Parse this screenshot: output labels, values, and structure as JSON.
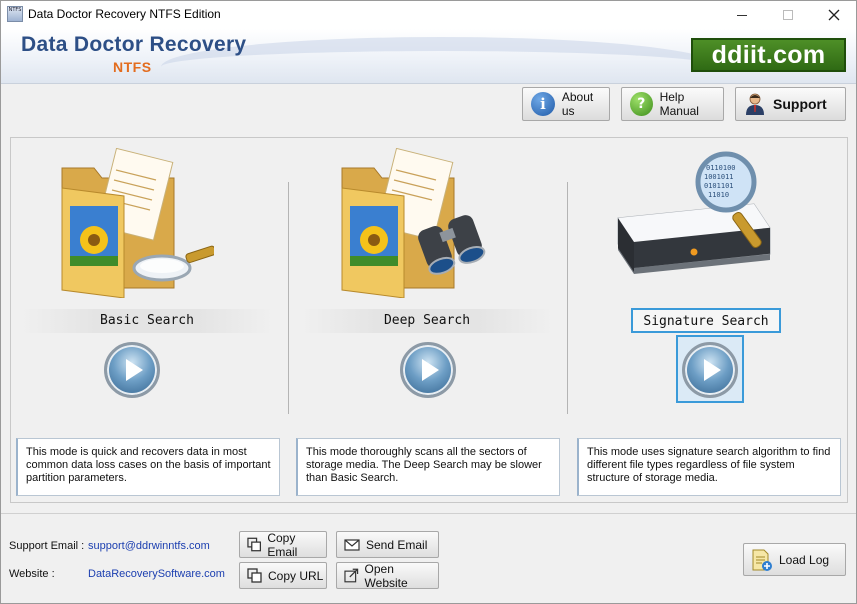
{
  "window": {
    "title": "Data Doctor Recovery NTFS Edition",
    "icon_text": "NTFS"
  },
  "banner": {
    "title": "Data Doctor Recovery",
    "subtitle": "NTFS",
    "logo": "ddiit.com"
  },
  "toolbar": {
    "about_label": "About us",
    "help_label": "Help Manual",
    "support_label": "Support"
  },
  "modes": [
    {
      "label": "Basic Search",
      "icon": "folder-magnifier-icon",
      "description": "This mode is quick and recovers data in most common data loss cases on the basis of important partition parameters.",
      "selected": false
    },
    {
      "label": "Deep Search",
      "icon": "folder-binoculars-icon",
      "description": "This mode thoroughly scans all the sectors of storage media. The Deep Search may be slower than Basic Search.",
      "selected": false
    },
    {
      "label": "Signature Search",
      "icon": "drive-magnifier-icon",
      "description": "This mode uses signature search algorithm to find different file types regardless of file system structure of storage media.",
      "selected": true
    }
  ],
  "footer": {
    "support_email_label": "Support Email :",
    "support_email": "support@ddrwinntfs.com",
    "website_label": "Website :",
    "website": "DataRecoverySoftware.com",
    "copy_email_label": "Copy Email",
    "send_email_label": "Send Email",
    "copy_url_label": "Copy URL",
    "open_website_label": "Open Website",
    "load_log_label": "Load Log"
  },
  "colors": {
    "brand_blue": "#2d4f86",
    "brand_orange": "#e36c1e",
    "logo_green": "#3b7a1a",
    "selection_blue": "#3a9ad9",
    "link_blue": "#1c3fb0"
  }
}
